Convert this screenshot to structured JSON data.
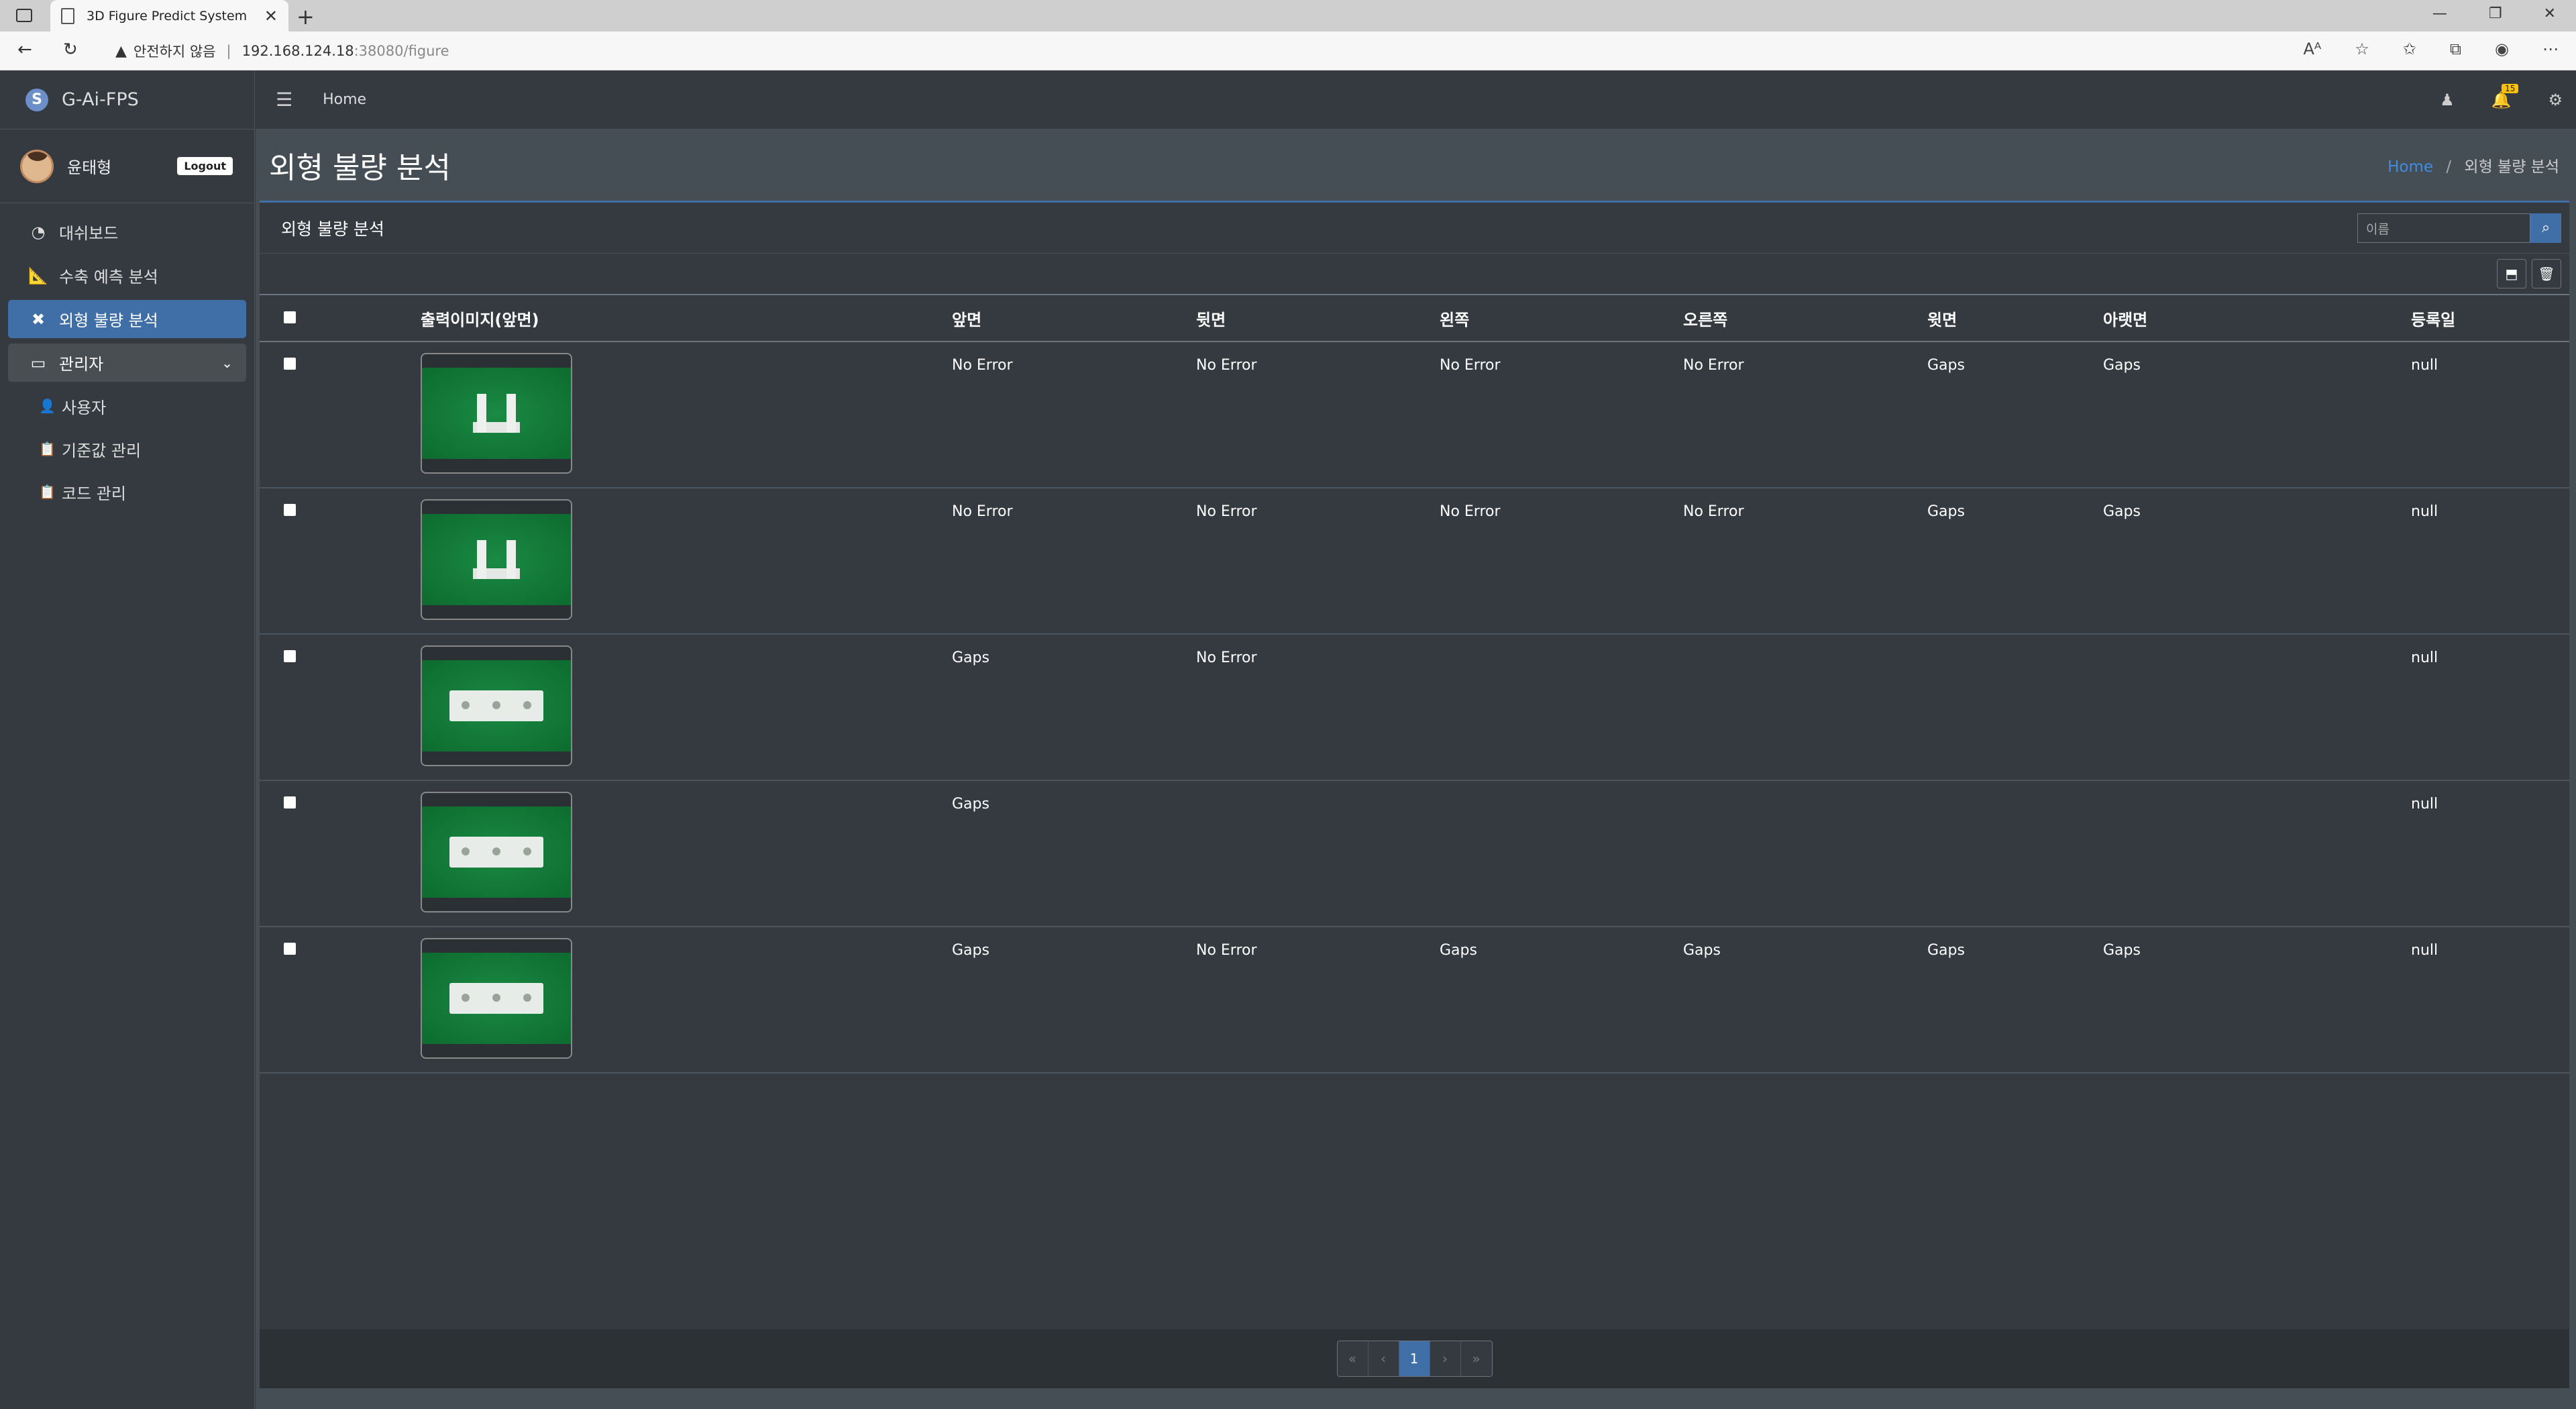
{
  "browser": {
    "tab_title": "3D Figure Predict System",
    "security_label": "안전하지 않음",
    "url_host": "192.168.124.18",
    "url_rest": ":38080/figure"
  },
  "brand": {
    "name": "G-Ai-FPS"
  },
  "user": {
    "name": "윤태형",
    "logout_label": "Logout"
  },
  "sidebar": {
    "items": [
      {
        "label": "대쉬보드"
      },
      {
        "label": "수축 예측 분석"
      },
      {
        "label": "외형 불량 분석"
      },
      {
        "label": "관리자"
      },
      {
        "label": "사용자"
      },
      {
        "label": "기준값 관리"
      },
      {
        "label": "코드 관리"
      }
    ]
  },
  "topnav": {
    "home_label": "Home",
    "badge": "15"
  },
  "page": {
    "title": "외형 불량 분석",
    "breadcrumb_home": "Home",
    "breadcrumb_current": "외형 불량 분석"
  },
  "card": {
    "title": "외형 불량 분석",
    "search_placeholder": "이름"
  },
  "table": {
    "headers": [
      "출력이미지(앞면)",
      "앞면",
      "뒷면",
      "왼쪽",
      "오른쪽",
      "윗면",
      "아랫면",
      "등록일"
    ],
    "rows": [
      {
        "shape": "u",
        "front": "No Error",
        "back": "No Error",
        "left": "No Error",
        "right": "No Error",
        "top": "Gaps",
        "bottom": "Gaps",
        "date": "null"
      },
      {
        "shape": "u",
        "front": "No Error",
        "back": "No Error",
        "left": "No Error",
        "right": "No Error",
        "top": "Gaps",
        "bottom": "Gaps",
        "date": "null"
      },
      {
        "shape": "block",
        "front": "Gaps",
        "back": "No Error",
        "left": "",
        "right": "",
        "top": "",
        "bottom": "",
        "date": "null"
      },
      {
        "shape": "block",
        "front": "Gaps",
        "back": "",
        "left": "",
        "right": "",
        "top": "",
        "bottom": "",
        "date": "null"
      },
      {
        "shape": "block",
        "front": "Gaps",
        "back": "No Error",
        "left": "Gaps",
        "right": "Gaps",
        "top": "Gaps",
        "bottom": "Gaps",
        "date": "null"
      }
    ]
  },
  "pagination": {
    "first": "«",
    "prev": "‹",
    "current": "1",
    "next": "›",
    "last": "»"
  },
  "colors": {
    "accent": "#3f6fa6",
    "sidebar_bg": "#343a40",
    "content_bg": "#454d55",
    "badge": "#ffc107"
  }
}
